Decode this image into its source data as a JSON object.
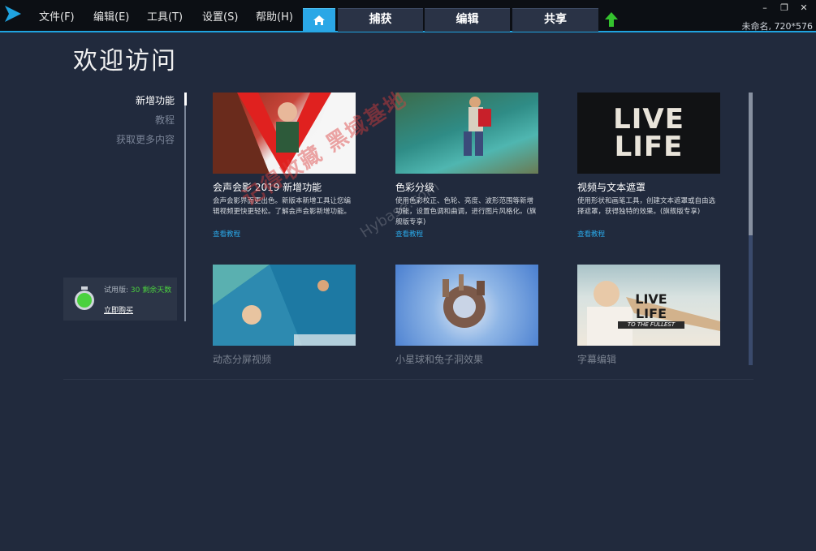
{
  "menu": {
    "items": [
      {
        "label": "文件(F)"
      },
      {
        "label": "编辑(E)"
      },
      {
        "label": "工具(T)"
      },
      {
        "label": "设置(S)"
      },
      {
        "label": "帮助(H)"
      }
    ]
  },
  "tabs": [
    {
      "icon": "home-icon"
    },
    {
      "label": "捕获"
    },
    {
      "label": "编辑"
    },
    {
      "label": "共享"
    }
  ],
  "window": {
    "minimize": "–",
    "restore": "❐",
    "close": "✕",
    "project_info": "未命名, 720*576"
  },
  "page": {
    "title": "欢迎访问"
  },
  "nav": {
    "items": [
      {
        "label": "新增功能"
      },
      {
        "label": "教程"
      },
      {
        "label": "获取更多内容"
      }
    ]
  },
  "trial": {
    "prefix": "试用版: ",
    "days": "30 剩余天数",
    "buy": "立即购买"
  },
  "cards": [
    {
      "title": "会声会影 2019 新增功能",
      "desc": "会声会影界面更出色。新版本新增工具让您编辑视频更快更轻松。了解会声会影新增功能。",
      "link": "查看教程"
    },
    {
      "title": "色彩分级",
      "desc": "使用色彩校正、色轮、亮度、波形范围等新增功能，设置色调和曲调，进行图片风格化。(旗舰版专享)",
      "link": "查看教程"
    },
    {
      "title": "视频与文本遮罩",
      "desc": "使用形状和画笔工具，创建文本遮罩或自由选择遮罩，获得独特的效果。(旗舰版专享)",
      "link": "查看教程",
      "thumb_text": "LIVE LIFE"
    },
    {
      "title": "动态分屏视频"
    },
    {
      "title": "小星球和兔子洞效果"
    },
    {
      "title": "字幕编辑",
      "thumb_text": "LIVE LIFE",
      "thumb_subtext": "TO THE FULLEST"
    }
  ],
  "watermark": {
    "text": "记得收藏 黑域基地",
    "sub": "Hybase.com"
  },
  "colors": {
    "accent": "#2aa7e6",
    "background": "#212a3d",
    "topbar": "#0c0f14",
    "trial_days": "#4bd13f",
    "upload_arrow": "#34c22e"
  }
}
